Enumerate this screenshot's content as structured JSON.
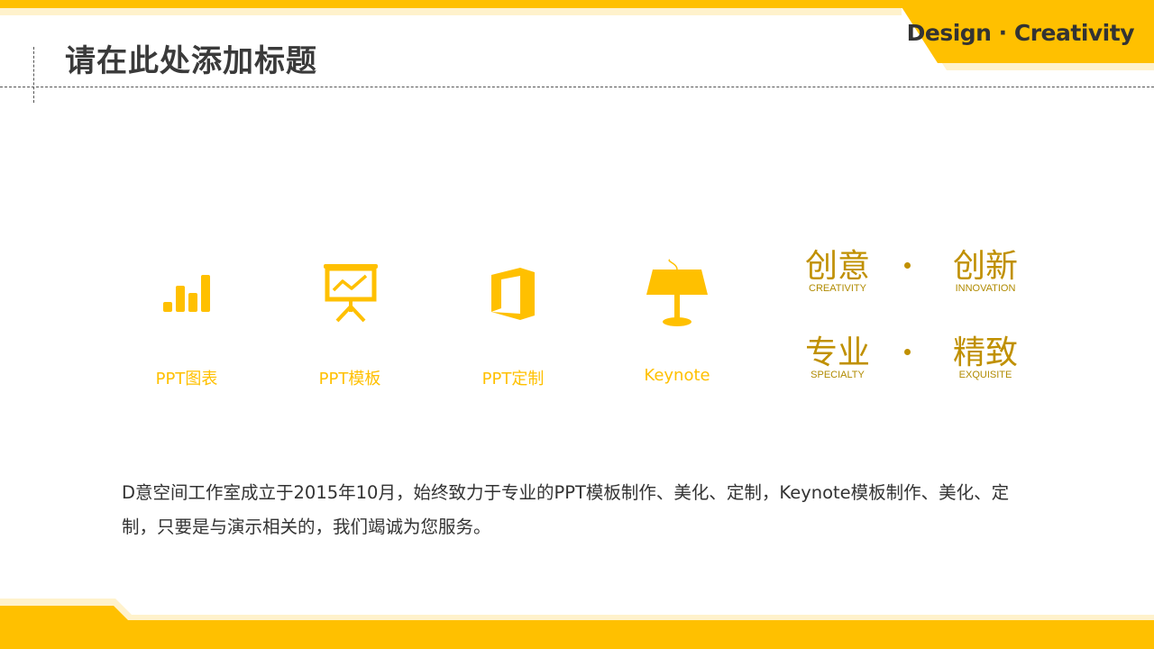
{
  "header": {
    "title": "请在此处添加标题",
    "tagline": "Design · Creativity"
  },
  "colors": {
    "accent": "#FFC000",
    "accent_light": "#FFF2CC",
    "keyword": "#C09000",
    "text": "#333333"
  },
  "services": [
    {
      "icon": "bar-chart-icon",
      "label": "PPT图表"
    },
    {
      "icon": "presentation-board-icon",
      "label": "PPT模板"
    },
    {
      "icon": "office-logo-icon",
      "label": "PPT定制"
    },
    {
      "icon": "keynote-podium-icon",
      "label": "Keynote"
    }
  ],
  "keywords": [
    {
      "zh": "创意",
      "en": "CREATIVITY"
    },
    {
      "zh": "创新",
      "en": "INNOVATION"
    },
    {
      "zh": "专业",
      "en": "SPECIALTY"
    },
    {
      "zh": "精致",
      "en": "EXQUISITE"
    }
  ],
  "description": "D意空间工作室成立于2015年10月，始终致力于专业的PPT模板制作、美化、定制，Keynote模板制作、美化、定制，只要是与演示相关的，我们竭诚为您服务。"
}
